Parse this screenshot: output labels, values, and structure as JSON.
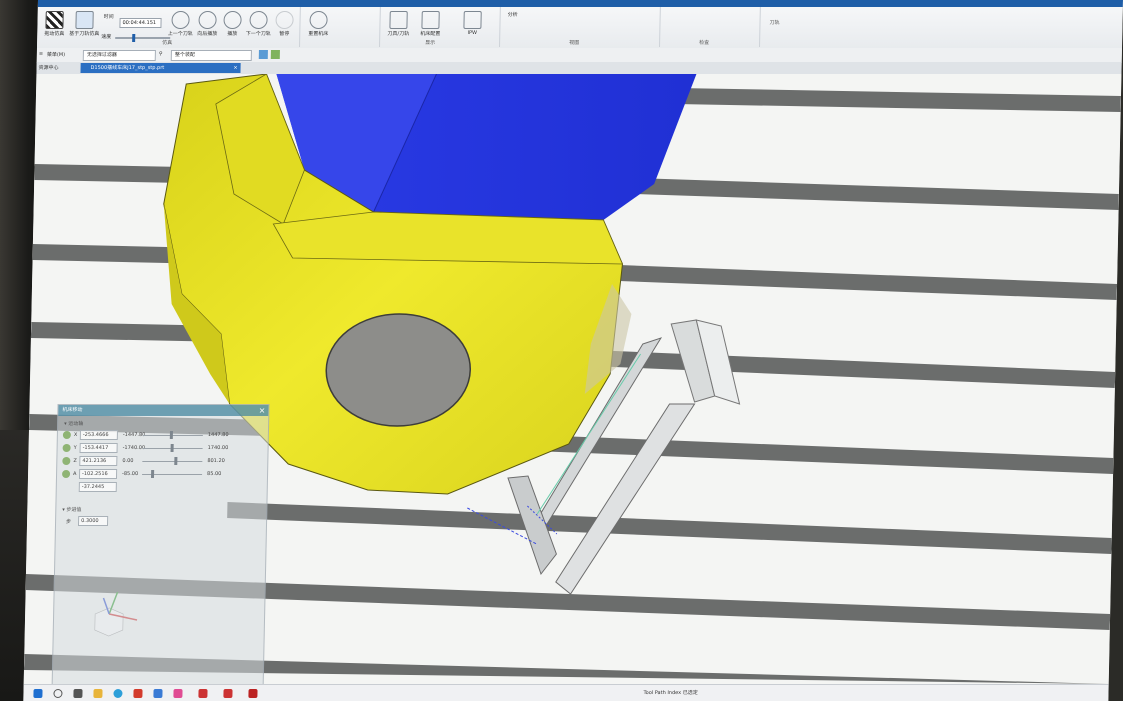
{
  "ribbon": {
    "sim_label": "拖动仿真",
    "step_label": "基于刀轨仿真",
    "time_label": "时间",
    "time_value": "00:04:44.151",
    "speed_label": "速度",
    "prev_label": "上一个刀轨",
    "play_back_label": "向后播放",
    "play_label": "播放",
    "next_label": "下一个刀轨",
    "stop_label": "暂停",
    "reset_label": "重置机床",
    "group_sim": "仿真",
    "toolpath_label": "刀具/刀轨",
    "machine_label": "机床配置",
    "group_display": "显示",
    "ipw_label": "IPW",
    "analysis_label": "分析",
    "group_view": "视图",
    "group_check": "检查",
    "tool_group": "刀轨"
  },
  "cmdbar": {
    "menu_label": "菜单(M)",
    "filter_value": "无选择过滤器",
    "scope_value": "整个装配"
  },
  "tabs": {
    "side_tab": "资源中心",
    "file_tab": "D1500摆线车床J17_stp_stp.prt"
  },
  "panel": {
    "title": "机床移动",
    "section1": "运动轴",
    "rows": [
      {
        "axis": "X",
        "value": "-253.4666",
        "lo": "-1447.80",
        "hi": "1447.80",
        "frac": 0.45
      },
      {
        "axis": "Y",
        "value": "-153.4417",
        "lo": "-1740.00",
        "hi": "1740.00",
        "frac": 0.46
      },
      {
        "axis": "Z",
        "value": "421.2136",
        "lo": "0.00",
        "hi": "801.20",
        "frac": 0.53
      },
      {
        "axis": "A",
        "value": "-102.2516",
        "lo": "-85.00",
        "hi": "85.00",
        "frac": 0.15
      }
    ],
    "row5_value": "-37.2445",
    "section2": "步进值",
    "tol_label": "步",
    "tol_value": "0.3000"
  },
  "taskbar": {
    "text": "Tool Path Index 已选定"
  },
  "colors": {
    "part": "#e8e325",
    "fixture": "#2b3ee0",
    "hole": "#8d8d8a",
    "accent": "#1f5ea8"
  }
}
